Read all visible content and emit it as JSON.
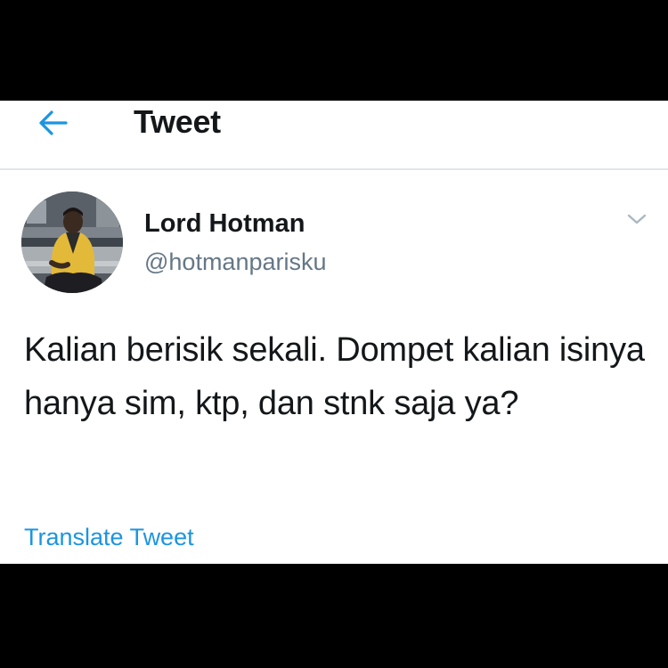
{
  "header": {
    "back_icon": "arrow-left-icon",
    "title": "Tweet"
  },
  "tweet": {
    "author": {
      "display_name": "Lord Hotman",
      "handle": "@hotmanparisku",
      "avatar": "profile-photo"
    },
    "menu_icon": "chevron-down-icon",
    "text": "Kalian berisik sekali. Dompet kalian isinya hanya sim, ktp, dan stnk saja ya?",
    "translate_label": "Translate Tweet"
  },
  "colors": {
    "accent": "#1b95e0",
    "text_primary": "#14171a",
    "text_secondary": "#657786",
    "divider": "#e2e6ea",
    "frame": "#000000"
  }
}
